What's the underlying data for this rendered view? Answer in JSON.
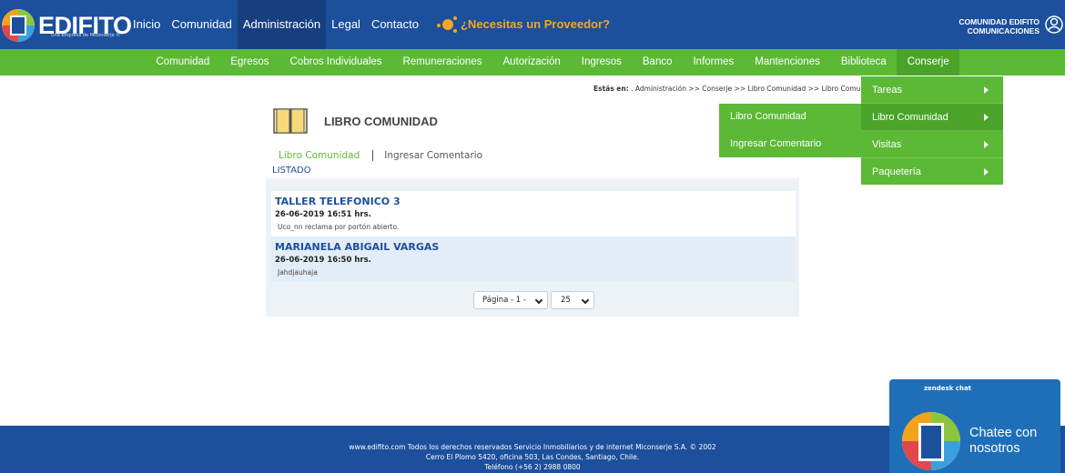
{
  "brand": {
    "name": "EDIFITO",
    "tagline": "Una empresa de Miconserje ©"
  },
  "topnav": {
    "items": [
      "Inicio",
      "Comunidad",
      "Administración",
      "Legal",
      "Contacto"
    ],
    "provider_cta": "¿Necesitas un Proveedor?"
  },
  "account": {
    "line1": "COMUNIDAD EDIFITO",
    "line2": "COMUNICACIONES"
  },
  "greennav": {
    "items": [
      "Comunidad",
      "Egresos",
      "Cobros Individuales",
      "Remuneraciones",
      "Autorización",
      "Ingresos",
      "Banco",
      "Informes",
      "Mantenciones",
      "Biblioteca",
      "Conserje"
    ]
  },
  "breadcrumb": {
    "label": "Estás en:",
    "path": ". Administración >> Conserje >> Libro Comunidad >> Libro Comun"
  },
  "page": {
    "title": "LIBRO COMUNIDAD",
    "tab_active": "Libro Comunidad",
    "tab_other": "Ingresar Comentario",
    "list_label": "LISTADO"
  },
  "entries": [
    {
      "name": "TALLER TELEFONICO 3",
      "date": "26-06-2019 16:51 hrs.",
      "text": "Uco_nn reclama por portón abierto."
    },
    {
      "name": "MARIANELA ABIGAIL VARGAS",
      "date": "26-06-2019 16:50 hrs.",
      "text": "Jahdjauhaja"
    }
  ],
  "pagination": {
    "page": "Página - 1 -",
    "per_page": "25"
  },
  "dropdown_main": [
    "Tareas",
    "Libro Comunidad",
    "Visitas",
    "Paquetería"
  ],
  "dropdown_sub": [
    "Libro Comunidad",
    "Ingresar Comentario"
  ],
  "footer": {
    "line1": "www.edifito.com Todos los derechos reservados Servicio Inmobiliarios y de internet Miconserje S.A. © 2002",
    "line2": "Cerro El Plomo 5420, oficina 503, Las Condes, Santiago, Chile.",
    "line3": "Teléfono (+56 2) 2988 0800"
  },
  "chat": {
    "brand": "zendesk chat",
    "cta": "Chatee con nosotros"
  },
  "colors": {
    "primary_blue": "#1c4f9c",
    "green": "#5cb936",
    "orange": "#f5a623"
  }
}
